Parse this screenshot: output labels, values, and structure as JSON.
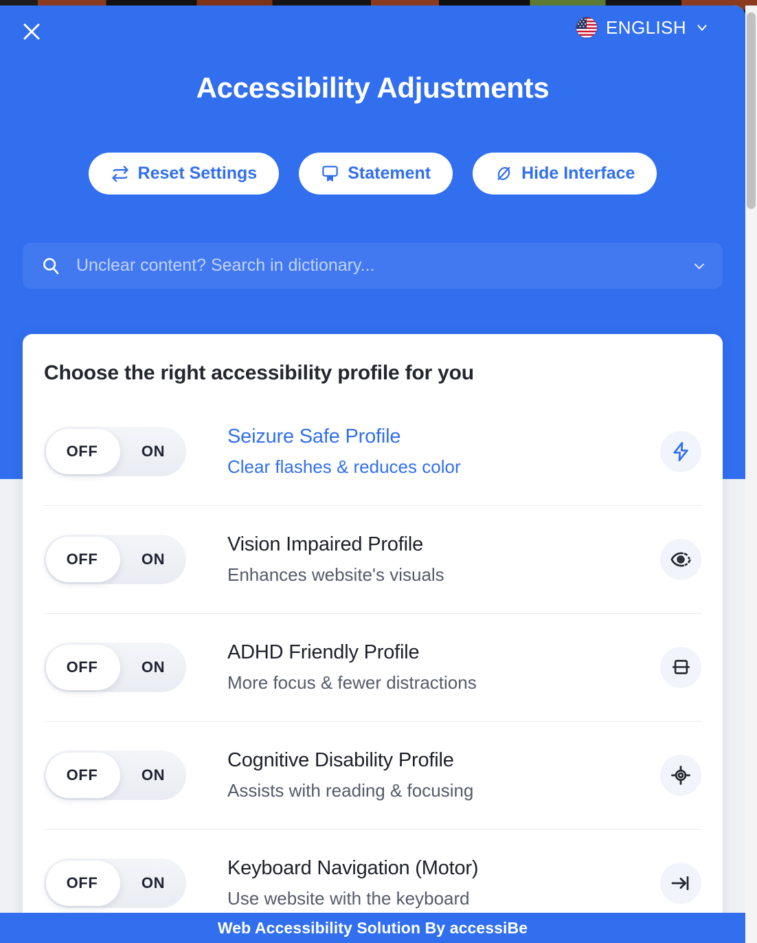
{
  "header": {
    "close_icon": "close-icon",
    "title": "Accessibility Adjustments",
    "language": {
      "flag_icon": "us-flag-icon",
      "label": "ENGLISH",
      "chevron_icon": "chevron-down-icon"
    },
    "actions": [
      {
        "label": "Reset Settings",
        "icon": "reset-arrows-icon"
      },
      {
        "label": "Statement",
        "icon": "certificate-icon"
      },
      {
        "label": "Hide Interface",
        "icon": "slashed-circle-icon"
      }
    ]
  },
  "search": {
    "icon": "search-icon",
    "placeholder": "Unclear content? Search in dictionary...",
    "value": "",
    "chevron_icon": "chevron-down-icon"
  },
  "profiles_card": {
    "title": "Choose the right accessibility profile for you",
    "toggle_labels": {
      "off": "OFF",
      "on": "ON"
    },
    "items": [
      {
        "name": "Seizure Safe Profile",
        "description": "Clear flashes & reduces color",
        "icon": "lightning-bolt-icon",
        "state": "OFF",
        "highlighted": true
      },
      {
        "name": "Vision Impaired Profile",
        "description": "Enhances website's visuals",
        "icon": "eye-icon",
        "state": "OFF",
        "highlighted": false
      },
      {
        "name": "ADHD Friendly Profile",
        "description": "More focus & fewer distractions",
        "icon": "focus-band-icon",
        "state": "OFF",
        "highlighted": false
      },
      {
        "name": "Cognitive Disability Profile",
        "description": "Assists with reading & focusing",
        "icon": "crosshair-target-icon",
        "state": "OFF",
        "highlighted": false
      },
      {
        "name": "Keyboard Navigation (Motor)",
        "description": "Use website with the keyboard",
        "icon": "tab-arrow-icon",
        "state": "OFF",
        "highlighted": false
      }
    ]
  },
  "footer": {
    "text": "Web Accessibility Solution By accessiBe"
  },
  "colors": {
    "brand_blue": "#316fef",
    "search_field": "#4279f1",
    "card_white": "#ffffff",
    "text_dark": "#1d1f29",
    "text_muted": "#555a6b"
  }
}
